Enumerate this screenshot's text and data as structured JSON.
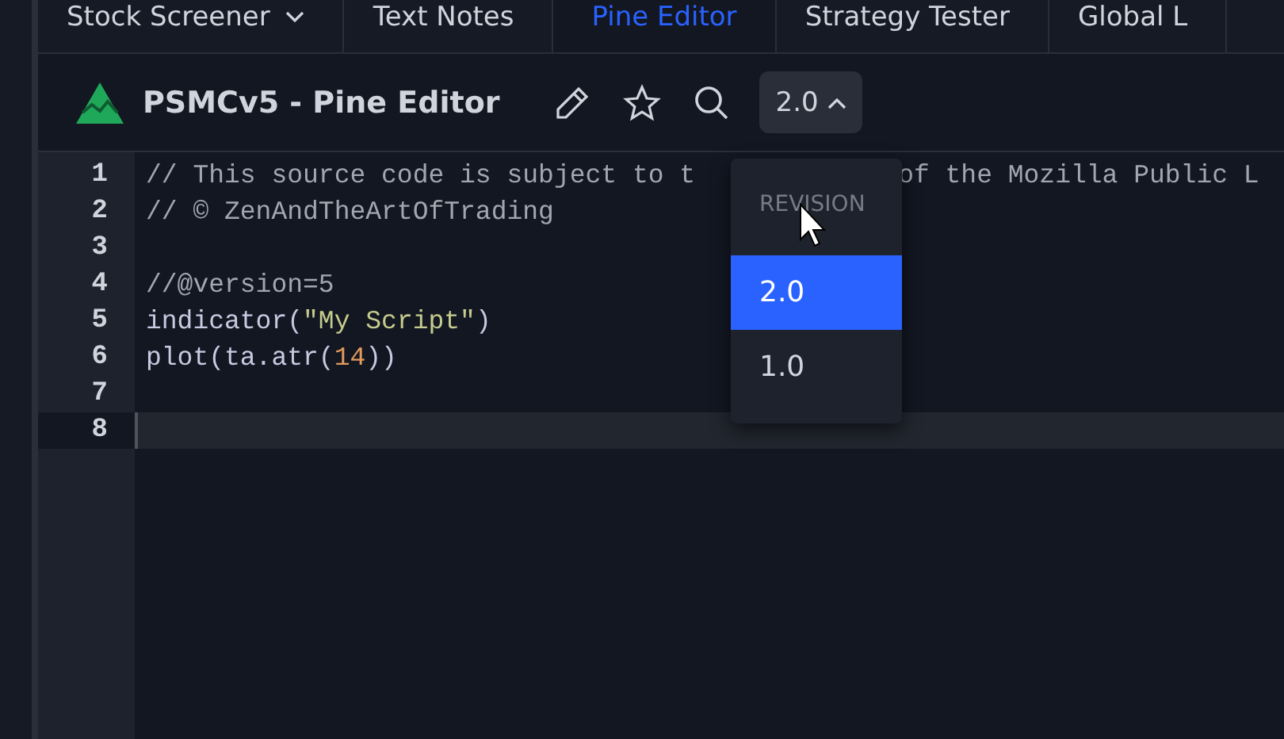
{
  "tabs": [
    {
      "label": "Stock Screener",
      "selected": false,
      "dropdown": true
    },
    {
      "label": "Text Notes",
      "selected": false,
      "dropdown": false
    },
    {
      "label": "Pine Editor",
      "selected": true,
      "dropdown": false
    },
    {
      "label": "Strategy Tester",
      "selected": false,
      "dropdown": false
    },
    {
      "label": "Global L",
      "selected": false,
      "dropdown": false
    }
  ],
  "toolbar": {
    "title": "PSMCv5 - Pine Editor",
    "version": "2.0"
  },
  "editor": {
    "lines": [
      {
        "number": "1",
        "current": false,
        "tokens": [
          {
            "kind": "comment",
            "text": "// This source code is subject to t"
          },
          {
            "kind": "comment",
            "text": "of the Mozilla Public L",
            "gap": true
          }
        ]
      },
      {
        "number": "2",
        "current": false,
        "tokens": [
          {
            "kind": "comment",
            "text": "// © ZenAndTheArtOfTrading"
          }
        ]
      },
      {
        "number": "3",
        "current": false
      },
      {
        "number": "4",
        "current": false,
        "tokens": [
          {
            "kind": "comment",
            "text": "//@version=5"
          }
        ]
      },
      {
        "number": "5",
        "current": false,
        "tokens": [
          {
            "kind": "plain",
            "text": "indicator("
          },
          {
            "kind": "string",
            "text": "\"My Script\""
          },
          {
            "kind": "plain",
            "text": ")"
          }
        ]
      },
      {
        "number": "6",
        "current": false,
        "tokens": [
          {
            "kind": "plain",
            "text": "plot(ta.atr("
          },
          {
            "kind": "number",
            "text": "14"
          },
          {
            "kind": "plain",
            "text": "))"
          }
        ]
      },
      {
        "number": "7",
        "current": false
      },
      {
        "number": "8",
        "current": true
      }
    ]
  },
  "revision_menu": {
    "header": "REVISION",
    "items": [
      {
        "label": "2.0",
        "selected": true
      },
      {
        "label": "1.0",
        "selected": false
      }
    ]
  }
}
